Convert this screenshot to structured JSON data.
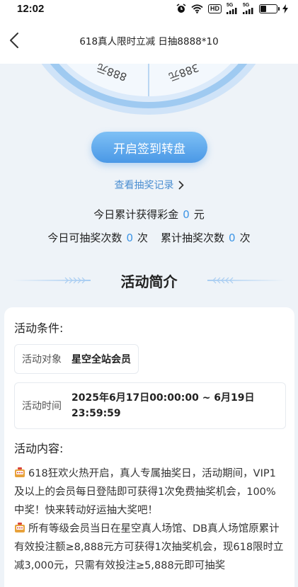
{
  "status_bar": {
    "time": "12:02",
    "hd_label": "HD",
    "sig1_label": "5G",
    "sig2_label": "5G"
  },
  "nav": {
    "title": "618真人限时立减 日抽8888*10"
  },
  "wheel": {
    "labels": [
      "888元",
      "388元"
    ]
  },
  "spin_button_label": "开启签到转盘",
  "records_link_label": "查看抽奖记录",
  "stats": {
    "today_prize_label": "今日累计获得彩金",
    "today_prize_value": "0",
    "today_prize_unit": "元",
    "today_draws_label": "今日可抽奖次数",
    "today_draws_value": "0",
    "today_draws_unit": "次",
    "total_draws_label": "累计抽奖次数",
    "total_draws_value": "0",
    "total_draws_unit": "次"
  },
  "section_title": "活动简介",
  "conditions": {
    "heading": "活动条件:",
    "target_label": "活动对象",
    "target_value": "星空全站会员",
    "time_label": "活动时间",
    "time_value_line1": "2025年6月17日00:00:00 ~ 6月19日",
    "time_value_line2": "23:59:59"
  },
  "content": {
    "heading": "活动内容:",
    "para1": "618狂欢火热开启，真人专属抽奖日，活动期间，VIP1及以上的会员每日登陆即可获得1次免费抽奖机会，100%中奖！快来转动好运抽大奖吧！",
    "para2": "所有等级会员当日在星空真人场馆、DB真人场馆原累计有效投注额≥8,888元方可获得1次抽奖机会，现618限时立减3,000元，只需有效投注≥5,888元即可抽奖"
  },
  "colors": {
    "accent": "#4a98e6",
    "number": "#3d95e6",
    "link": "#4c8fd1"
  }
}
